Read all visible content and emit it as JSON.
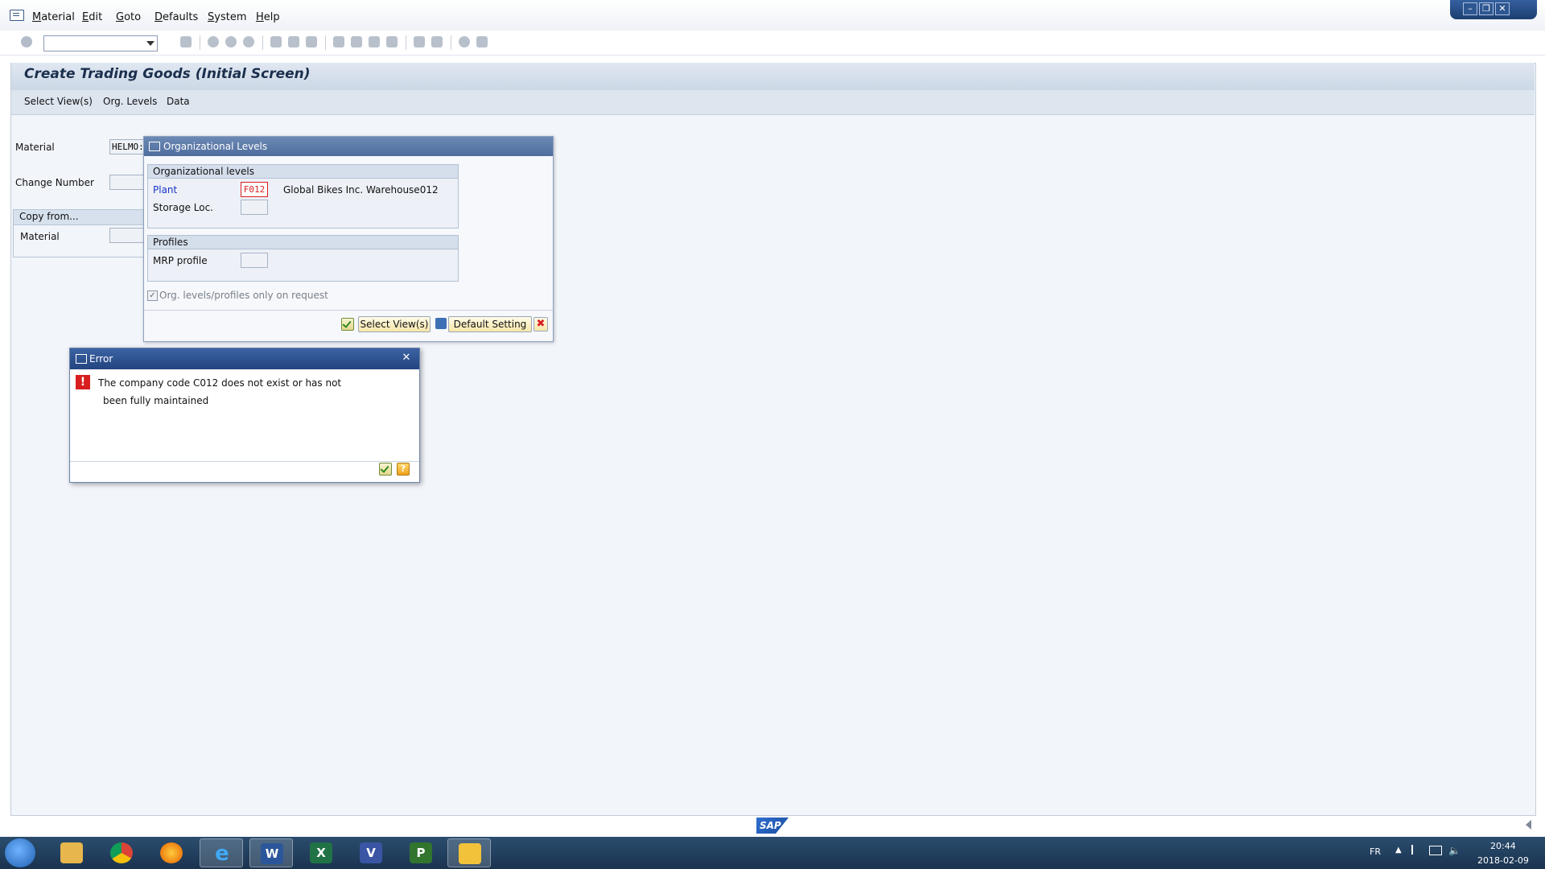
{
  "menubar": {
    "items": [
      "Material",
      "Edit",
      "Goto",
      "Defaults",
      "System",
      "Help"
    ]
  },
  "window_controls": {
    "minimize": "–",
    "restore": "❐",
    "close": "✕"
  },
  "toolbar": {
    "command_field_value": ""
  },
  "page": {
    "title": "Create Trading Goods (Initial Screen)",
    "app_toolbar": [
      "Select View(s)",
      "Org. Levels",
      "Data"
    ]
  },
  "form": {
    "material_label": "Material",
    "material_value": "HELMO:",
    "change_number_label": "Change Number",
    "change_number_value": "",
    "copy_from": {
      "header": "Copy from...",
      "material_label": "Material",
      "material_value": ""
    }
  },
  "org_levels_popup": {
    "title": "Organizational Levels",
    "org_group_header": "Organizational levels",
    "plant_label": "Plant",
    "plant_value": "F012",
    "plant_description": "Global Bikes Inc. Warehouse012",
    "storage_loc_label": "Storage Loc.",
    "storage_loc_value": "",
    "profiles_header": "Profiles",
    "mrp_profile_label": "MRP profile",
    "mrp_profile_value": "",
    "only_on_request_label": "Org. levels/profiles only on request",
    "buttons": {
      "select_views": "Select View(s)",
      "default_setting": "Default Setting"
    }
  },
  "error_popup": {
    "title": "Error",
    "message_line1": "The company code C012 does not exist or has not",
    "message_line2": "been fully maintained"
  },
  "footer": {
    "logo_text": "SAP"
  },
  "taskbar": {
    "apps": [
      "start",
      "file-explorer",
      "chrome",
      "firefox",
      "internet-explorer",
      "word",
      "excel",
      "visio",
      "project",
      "sap-logon"
    ],
    "language": "FR",
    "time": "20:44",
    "date": "2018-02-09"
  },
  "colors": {
    "title_text": "#1b2f4d",
    "error_red": "#d81e1e",
    "link_blue": "#1a33c8"
  }
}
